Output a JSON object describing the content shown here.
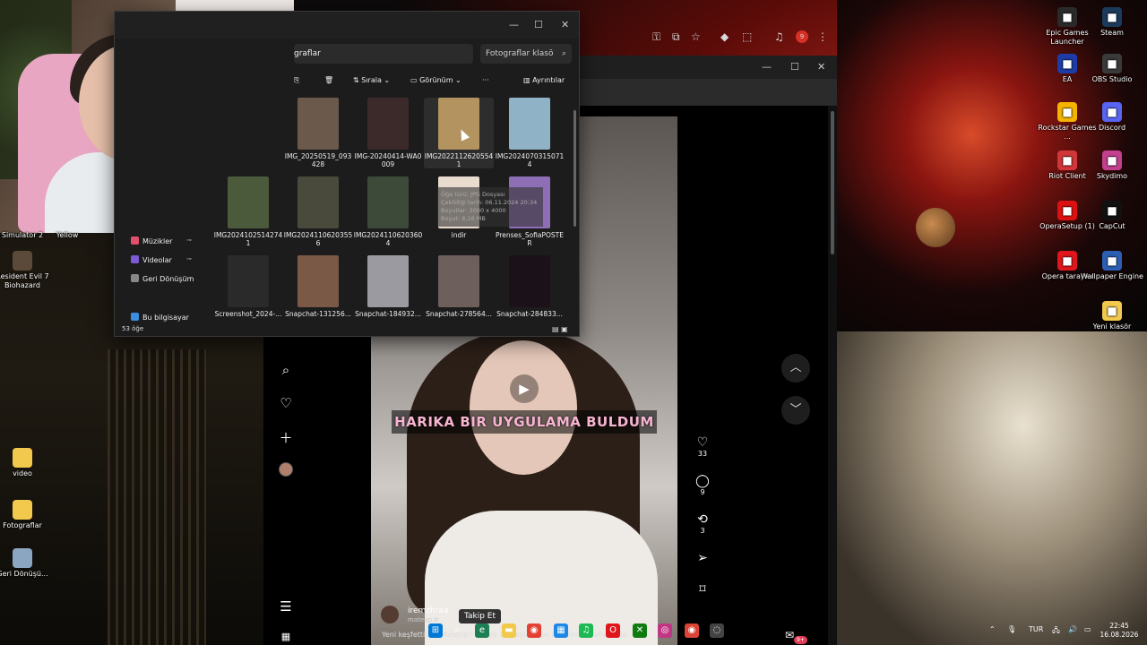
{
  "desktop": {
    "icons_right": [
      {
        "label": "Epic Games Launcher",
        "icon": "epic-icon",
        "color": "#2a2a2a"
      },
      {
        "label": "Steam",
        "icon": "steam-icon",
        "color": "#1b3a5c"
      },
      {
        "label": "EA",
        "icon": "ea-icon",
        "color": "#1e3ca8"
      },
      {
        "label": "OBS Studio",
        "icon": "obs-icon",
        "color": "#3a3a3a"
      },
      {
        "label": "Rockstar Games ...",
        "icon": "rockstar-icon",
        "color": "#f4b400"
      },
      {
        "label": "Discord",
        "icon": "discord-icon",
        "color": "#5865f2"
      },
      {
        "label": "Riot Client",
        "icon": "riot-icon",
        "color": "#d13639"
      },
      {
        "label": "Skydimo",
        "icon": "skydimo-icon",
        "color": "#c3408f"
      },
      {
        "label": "OperaSetup (1)",
        "icon": "opera-setup-icon",
        "color": "#d11"
      },
      {
        "label": "CapCut",
        "icon": "capcut-icon",
        "color": "#111"
      },
      {
        "label": "Opera tarayıcı",
        "icon": "opera-icon",
        "color": "#e0161c"
      },
      {
        "label": "Wallpaper Engine",
        "icon": "wallpaper-engine-icon",
        "color": "#2c5fb3"
      },
      {
        "label": "Yeni klasör",
        "icon": "folder-icon",
        "color": "#f2c94c"
      }
    ],
    "icons_left": [
      {
        "label": "Simulator 2",
        "icon": "app-icon"
      },
      {
        "label": "Yellow",
        "icon": "app-icon"
      },
      {
        "label": "Resident Evil 7 Biohazard",
        "icon": "re7-icon"
      },
      {
        "label": "video",
        "icon": "folder-icon"
      },
      {
        "label": "Fotograflar",
        "icon": "folder-icon"
      },
      {
        "label": "Geri Dönüşü...",
        "icon": "recycle-bin-icon"
      }
    ]
  },
  "browser": {
    "badge_count": "9",
    "caption": "HARIKA BIR UYGULAMA BULDUM",
    "actions": [
      {
        "icon": "heart-icon",
        "count": "33"
      },
      {
        "icon": "comment-icon",
        "count": "9"
      },
      {
        "icon": "repost-icon",
        "count": "3"
      },
      {
        "icon": "share-icon",
        "count": ""
      },
      {
        "icon": "bookmark-icon",
        "count": ""
      }
    ],
    "author": {
      "name": "iremzhraa",
      "sub": "mateup.tr"
    },
    "follow_label": "Takip Et",
    "description": "Yeni keşfettiğim MateUp'ı sizinle de paylaşmak istedim ... daha fazla",
    "inbox_badge": "9+"
  },
  "explorer": {
    "path": "graflar",
    "search_placeholder": "Fotograflar klasö",
    "commands": {
      "sort": "Sırala",
      "view": "Görünüm",
      "more": "···",
      "details": "Ayrıntılar"
    },
    "sidebar": [
      {
        "label": "Müzikler",
        "icon": "music-icon",
        "color": "#e0506a"
      },
      {
        "label": "Videolar",
        "icon": "video-icon",
        "color": "#7b5cd6"
      },
      {
        "label": "Geri Dönüşüm",
        "icon": "recycle-bin-icon",
        "color": "#888"
      },
      {
        "label": "Bu bilgisayar",
        "icon": "computer-icon",
        "color": "#3b8ee0"
      }
    ],
    "items": [
      {
        "label": "IMG_20250519_093428",
        "color": "#6b5a4c",
        "sel": false
      },
      {
        "label": "IMG-20240414-WA0009",
        "color": "#3c2a2a",
        "sel": false
      },
      {
        "label": "IMG20221126205541",
        "color": "#b3935f",
        "sel": true
      },
      {
        "label": "IMG20240703150714",
        "color": "#8fb2c7",
        "sel": false
      },
      {
        "label": "IMG20241025142741",
        "color": "#4b5a3a",
        "sel": false
      },
      {
        "label": "IMG20241106203556",
        "color": "#4a4a3c",
        "sel": false
      },
      {
        "label": "IMG20241106203604",
        "color": "#3d4a3a",
        "sel": false
      },
      {
        "label": "indir",
        "color": "#e9dccf",
        "sel": false
      },
      {
        "label": "Prenses_SofiaPOSTER",
        "color": "#8e6fb5",
        "sel": false
      },
      {
        "label": "Screenshot_2024-...",
        "color": "#2a2a2a",
        "sel": false
      },
      {
        "label": "Snapchat-131256...",
        "color": "#7a5a46",
        "sel": false
      },
      {
        "label": "Snapchat-184932...",
        "color": "#9a9aa0",
        "sel": false
      },
      {
        "label": "Snapchat-278564...",
        "color": "#6c5f5c",
        "sel": false
      },
      {
        "label": "Snapchat-284833...",
        "color": "#1a1218",
        "sel": false
      }
    ],
    "tooltip": "Öğe türü: JPG Dosyası\nÇekildiği tarih: 06.11.2024 20:34\nBoyutlar: 3000 x 4000\nBoyut: 8,16 MB",
    "status": "53 öğe"
  },
  "taskbar": {
    "tray_lang": "TUR",
    "time": "22:45",
    "date": "16.08.2026"
  }
}
